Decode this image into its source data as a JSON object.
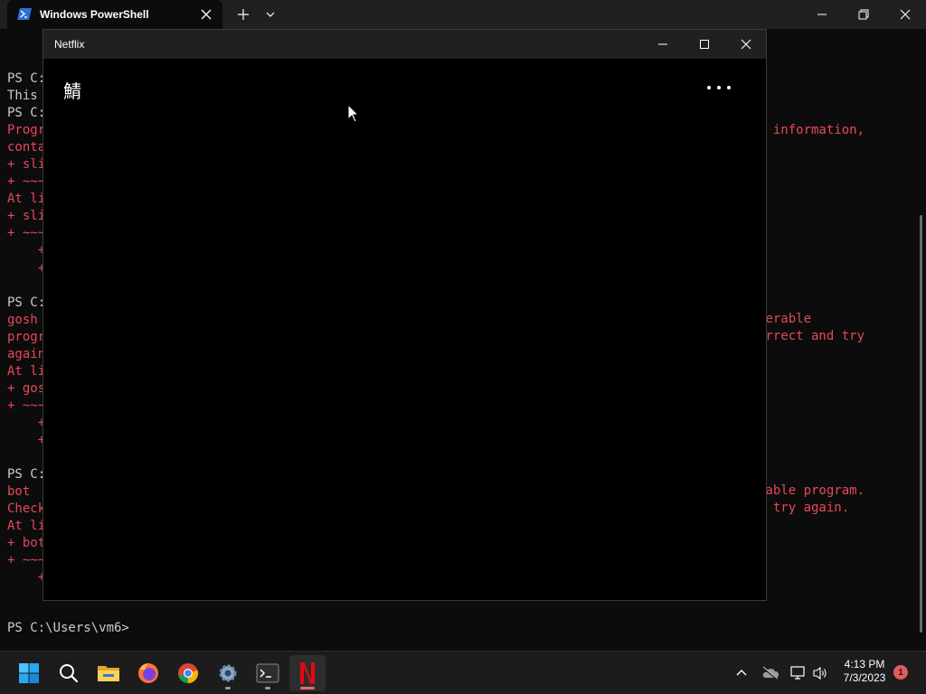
{
  "terminal": {
    "tab_title": "Windows PowerShell",
    "left_lines": [
      {
        "text": "PS C:",
        "kind": "normal"
      },
      {
        "text": "This",
        "kind": "normal"
      },
      {
        "text": "PS C:",
        "kind": "normal"
      },
      {
        "text": "Progr",
        "kind": "err"
      },
      {
        "text": "conta",
        "kind": "err"
      },
      {
        "text": "+ sli",
        "kind": "err"
      },
      {
        "text": "+ ~~~",
        "kind": "err"
      },
      {
        "text": "At li",
        "kind": "err"
      },
      {
        "text": "+ sli",
        "kind": "err"
      },
      {
        "text": "+ ~~~",
        "kind": "err"
      },
      {
        "text": "    +",
        "kind": "err"
      },
      {
        "text": "    +",
        "kind": "err"
      },
      {
        "text": "",
        "kind": "blank"
      },
      {
        "text": "PS C:",
        "kind": "normal"
      },
      {
        "text": "gosh",
        "kind": "err"
      },
      {
        "text": "progr",
        "kind": "err"
      },
      {
        "text": "again",
        "kind": "err"
      },
      {
        "text": "At li",
        "kind": "err"
      },
      {
        "text": "+ gos",
        "kind": "err"
      },
      {
        "text": "+ ~~~",
        "kind": "err"
      },
      {
        "text": "    +",
        "kind": "err"
      },
      {
        "text": "    +",
        "kind": "err"
      },
      {
        "text": "",
        "kind": "blank"
      },
      {
        "text": "PS C:",
        "kind": "normal"
      },
      {
        "text": "bot",
        "kind": "err"
      },
      {
        "text": "Check",
        "kind": "err"
      },
      {
        "text": "At li",
        "kind": "err"
      },
      {
        "text": "+ bot",
        "kind": "err"
      },
      {
        "text": "+ ~~~",
        "kind": "err"
      },
      {
        "text": "    +",
        "kind": "err"
      }
    ],
    "right_fragments": [
      {
        "text": "e information,"
      },
      {
        "text": "perable"
      },
      {
        "text": "orrect and try"
      },
      {
        "text": "rable program."
      },
      {
        "text": "d try again."
      }
    ],
    "prompt": "PS C:\\Users\\vm6>"
  },
  "netflix": {
    "title": "Netflix",
    "glyph": "鯖"
  },
  "taskbar": {
    "apps": [
      {
        "name": "start-button",
        "icon": "windows-icon"
      },
      {
        "name": "search-button",
        "icon": "search-icon"
      },
      {
        "name": "file-explorer-button",
        "icon": "folder-icon"
      },
      {
        "name": "firefox-button",
        "icon": "firefox-icon"
      },
      {
        "name": "chrome-button",
        "icon": "chrome-icon"
      },
      {
        "name": "settings-button",
        "icon": "gear-icon"
      },
      {
        "name": "terminal-button",
        "icon": "terminal-icon"
      },
      {
        "name": "netflix-button",
        "icon": "netflix-icon"
      }
    ],
    "time": "4:13 PM",
    "date": "7/3/2023",
    "notification_count": "1"
  },
  "colors": {
    "terminal_bg": "#0c0c0c",
    "error_text": "#e7485a",
    "normal_text": "#cccccc",
    "netflix_red": "#e50914",
    "taskbar_bg": "#1c1c1c",
    "notif_badge": "#e35b5b"
  }
}
